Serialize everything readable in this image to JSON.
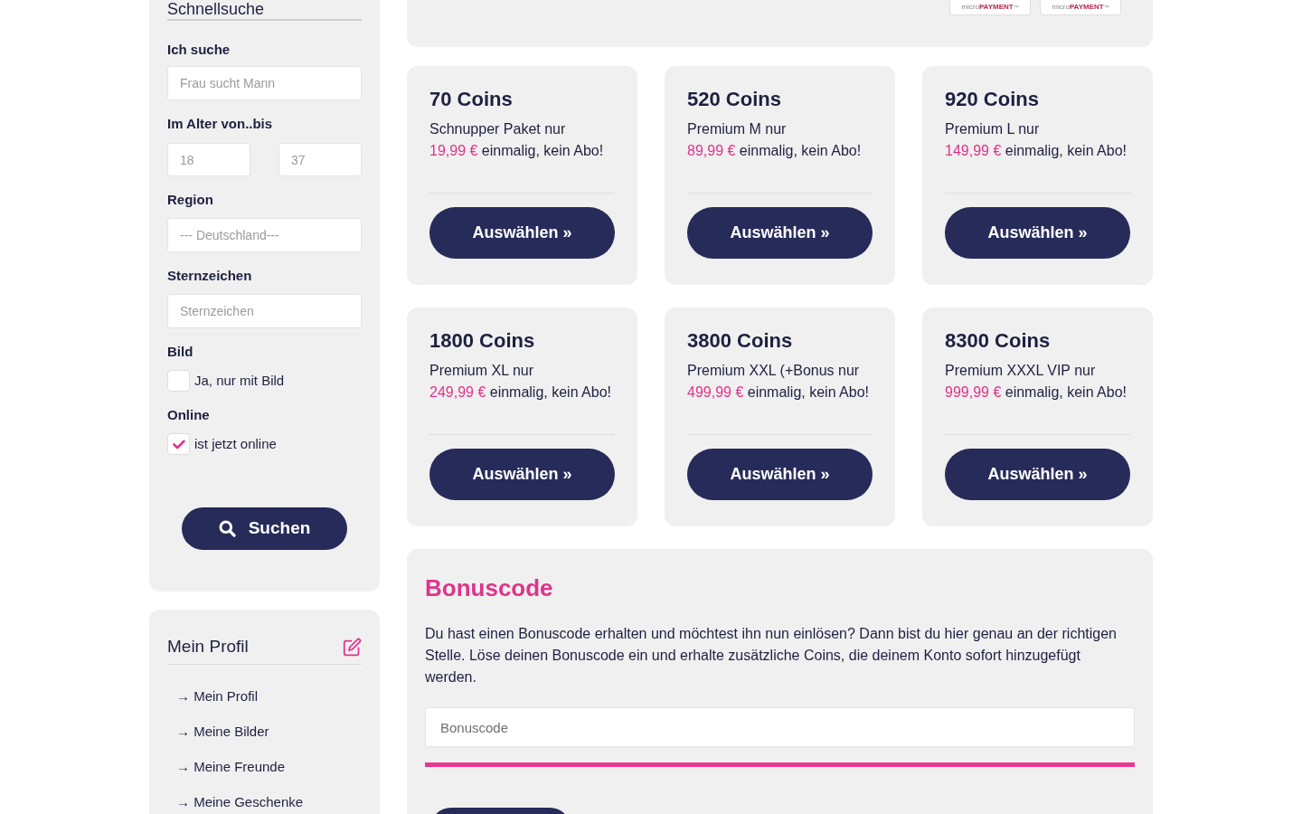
{
  "sidebar": {
    "quick_search": {
      "title": "Schnellsuche",
      "fields": [
        {
          "kind": "text",
          "label": "Ich suche",
          "placeholder": "Frau sucht Mann"
        },
        {
          "kind": "range",
          "label": "Im Alter von..bis",
          "placeholders": [
            "18",
            "37"
          ]
        },
        {
          "kind": "text",
          "label": "Region",
          "placeholder": "--- Deutschland---"
        },
        {
          "kind": "text",
          "label": "Sternzeichen",
          "placeholder": "Sternzeichen"
        },
        {
          "kind": "checkbox",
          "label": "Bild",
          "option": "Ja, nur mit Bild",
          "checked": false
        },
        {
          "kind": "checkbox",
          "label": "Online",
          "option": "ist jetzt online",
          "checked": true
        }
      ],
      "button": "Suchen"
    },
    "profile_menu": {
      "title": "Mein Profil",
      "items": [
        "→ Mein Profil",
        "→ Meine Bilder",
        "→ Meine Freunde",
        "→ Meine Geschenke"
      ]
    }
  },
  "payment_logos": [
    {
      "prefix": "micro",
      "brand": "PAYMENT",
      "mark": "™"
    },
    {
      "prefix": "micro",
      "brand": "PAYMENT",
      "mark": "™"
    }
  ],
  "packages": [
    {
      "title": "70 Coins",
      "description": "Schnupper Paket nur",
      "price": "19,99 €",
      "terms": "einmalig, kein Abo!",
      "button": "Auswählen »"
    },
    {
      "title": "520 Coins",
      "description": "Premium M nur",
      "price": "89,99 €",
      "terms": "einmalig, kein Abo!",
      "button": "Auswählen »"
    },
    {
      "title": "920 Coins",
      "description": "Premium L nur",
      "price": "149,99 €",
      "terms": "einmalig, kein Abo!",
      "button": "Auswählen »"
    },
    {
      "title": "1800 Coins",
      "description": "Premium XL nur",
      "price": "249,99 €",
      "terms": "einmalig, kein Abo!",
      "button": "Auswählen »"
    },
    {
      "title": "3800 Coins",
      "description": "Premium XXL (+Bonus nur",
      "price": "499,99 €",
      "terms": "einmalig, kein Abo!",
      "button": "Auswählen »"
    },
    {
      "title": "8300 Coins",
      "description": "Premium XXXL VIP nur",
      "price": "999,99 €",
      "terms": "einmalig, kein Abo!",
      "button": "Auswählen »"
    }
  ],
  "bonus": {
    "title": "Bonuscode",
    "text": "Du hast einen Bonuscode erhalten und möchtest ihn nun einlösen? Dann bist du hier genau an der richtigen Stelle. Löse deinen Bonuscode ein und erhalte zusätzliche Coins, die deinem Konto sofort hinzugefügt werden.",
    "placeholder": "Bonuscode"
  }
}
